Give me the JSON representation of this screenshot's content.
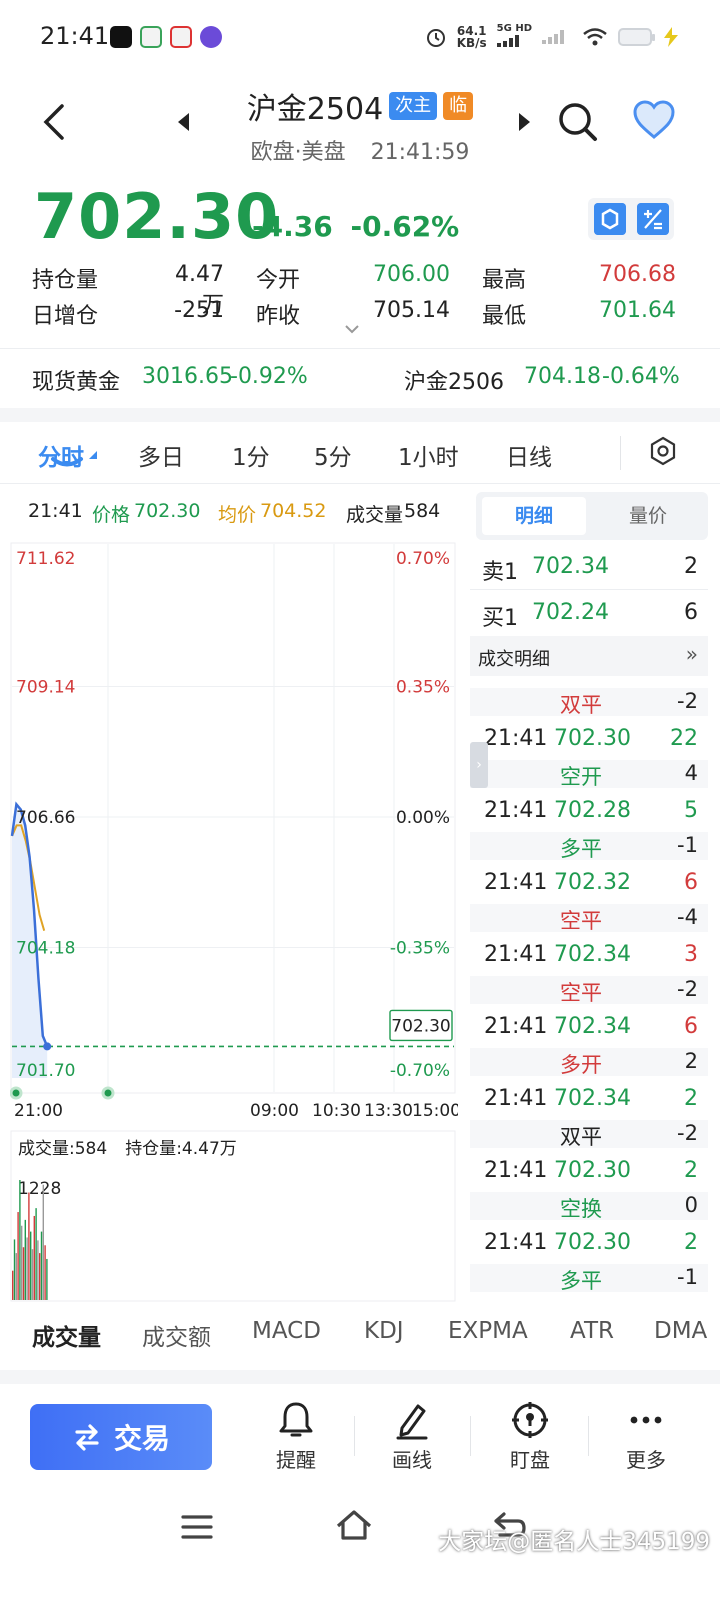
{
  "status_bar": {
    "time": "21:41",
    "net_speed_value": "64.1",
    "net_speed_unit": "KB/s",
    "network_type": "5G HD"
  },
  "header": {
    "title": "沪金2504",
    "badge_primary": "次主",
    "badge_secondary": "临",
    "session": "欧盘·美盘",
    "timestamp": "21:41:59"
  },
  "quote": {
    "last_price": "702.30",
    "change": "-4.36",
    "change_pct": "-0.62%",
    "stats": [
      {
        "label": "持仓量",
        "value": "4.47万",
        "label2": "今开",
        "value2": "706.00",
        "label3": "最高",
        "value3": "706.68"
      },
      {
        "label": "日增仓",
        "value": "-251",
        "label2": "昨收",
        "value2": "705.14",
        "label3": "最低",
        "value3": "701.64"
      }
    ]
  },
  "related": {
    "left_name": "现货黄金",
    "left_value": "3016.65",
    "left_pct": "-0.92%",
    "right_name": "沪金2506",
    "right_value": "704.18",
    "right_pct": "-0.64%"
  },
  "period_tabs": [
    "分时",
    "多日",
    "1分",
    "5分",
    "1小时",
    "日线"
  ],
  "chart_info": {
    "time": "21:41",
    "price_label": "价格",
    "price": "702.30",
    "avg_label": "均价",
    "avg": "704.52",
    "vol_label": "成交量",
    "vol": "584"
  },
  "chart_data": {
    "type": "line",
    "y_left_ticks": [
      "711.62",
      "709.14",
      "706.66",
      "704.18",
      "701.70"
    ],
    "y_right_ticks": [
      "0.70%",
      "0.35%",
      "0.00%",
      "-0.35%",
      "-0.70%"
    ],
    "x_ticks": [
      "21:00",
      "09:00",
      "10:30",
      "13:30",
      "15:00"
    ],
    "ylim": [
      701.7,
      711.62
    ],
    "reference_price": 706.66,
    "current_price_tag": "702.30",
    "series": [
      {
        "values": [
          706.3,
          706.9,
          706.8,
          706.5,
          705.9,
          704.9,
          703.6,
          702.5,
          702.3
        ]
      },
      {
        "values": [
          706.3,
          706.5,
          706.5,
          706.2,
          705.8,
          705.3,
          704.8,
          704.5
        ]
      }
    ],
    "volume": {
      "label": "成交量",
      "value": "584",
      "oi_label": "持仓量",
      "oi_value": "4.47万",
      "max_tick": "1228",
      "bars": [
        300,
        620,
        480,
        900,
        1228,
        760,
        540,
        820,
        640,
        1100,
        700,
        520,
        860,
        940,
        610,
        480,
        700,
        1180,
        560,
        420
      ]
    }
  },
  "right_panel": {
    "tabs": [
      "明细",
      "量价"
    ],
    "orderbook": [
      {
        "label": "卖1",
        "price": "702.34",
        "qty": "2"
      },
      {
        "label": "买1",
        "price": "702.24",
        "qty": "6"
      }
    ],
    "trades_title": "成交明细",
    "trades_more": "»",
    "trades": [
      {
        "type": "双平",
        "type_qty": "-2",
        "time": "21:41",
        "price": "702.30",
        "qty": "22"
      },
      {
        "type": "空开",
        "type_qty": "4",
        "time": "21:41",
        "price": "702.28",
        "qty": "5"
      },
      {
        "type": "多平",
        "type_qty": "-1",
        "time": "21:41",
        "price": "702.32",
        "qty": "6"
      },
      {
        "type": "空平",
        "type_qty": "-4",
        "time": "21:41",
        "price": "702.34",
        "qty": "3"
      },
      {
        "type": "空平",
        "type_qty": "-2",
        "time": "21:41",
        "price": "702.34",
        "qty": "6"
      },
      {
        "type": "多开",
        "type_qty": "2",
        "time": "21:41",
        "price": "702.34",
        "qty": "2"
      },
      {
        "type": "双平",
        "type_qty": "-2",
        "time": "21:41",
        "price": "702.30",
        "qty": "2"
      },
      {
        "type": "空换",
        "type_qty": "0",
        "time": "21:41",
        "price": "702.30",
        "qty": "2"
      },
      {
        "type": "多平",
        "type_qty": "-1"
      }
    ]
  },
  "indicator_tabs": [
    "成交量",
    "成交额",
    "MACD",
    "KDJ",
    "EXPMA",
    "ATR",
    "DMA"
  ],
  "toolbar": {
    "trade_label": "交易",
    "remind_label": "提醒",
    "draw_label": "画线",
    "watch_label": "盯盘",
    "more_label": "更多"
  },
  "watermark": "大家坛@匿名人士345199",
  "colors": {
    "up": "#d23b3b",
    "down": "#1f9a4f",
    "accent": "#3b8bf0",
    "avg_line": "#e0a325"
  }
}
